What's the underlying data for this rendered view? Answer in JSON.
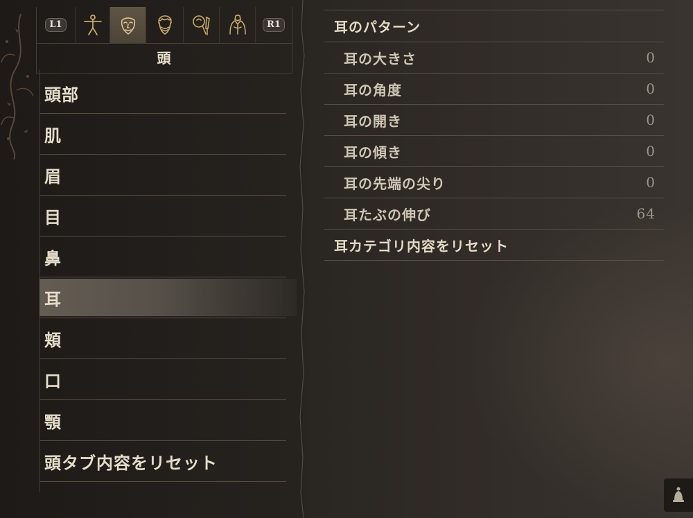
{
  "tab_bar": {
    "left_button": "L1",
    "right_button": "R1",
    "tabs": [
      {
        "icon": "body-icon"
      },
      {
        "icon": "face-icon"
      },
      {
        "icon": "hair-icon"
      },
      {
        "icon": "cosmetics-icon"
      },
      {
        "icon": "physique-icon"
      }
    ],
    "active_tab_title": "頭"
  },
  "categories": [
    {
      "label": "頭部"
    },
    {
      "label": "肌"
    },
    {
      "label": "眉"
    },
    {
      "label": "目"
    },
    {
      "label": "鼻"
    },
    {
      "label": "耳",
      "selected": true
    },
    {
      "label": "頬"
    },
    {
      "label": "口"
    },
    {
      "label": "顎"
    },
    {
      "label": "頭タブ内容をリセット"
    }
  ],
  "ear_panel": {
    "header": "耳のパターン",
    "rows": [
      {
        "label": "耳の大きさ",
        "value": "0"
      },
      {
        "label": "耳の角度",
        "value": "0"
      },
      {
        "label": "耳の開き",
        "value": "0"
      },
      {
        "label": "耳の傾き",
        "value": "0"
      },
      {
        "label": "耳の先端の尖り",
        "value": "0"
      },
      {
        "label": "耳たぶの伸び",
        "value": "64"
      }
    ],
    "reset": "耳カテゴリ内容をリセット"
  },
  "colors": {
    "accent_gold": "#c7aa6a",
    "divider": "#5b4c3f",
    "text": "#e6ddca",
    "value_text": "#9d9587"
  }
}
